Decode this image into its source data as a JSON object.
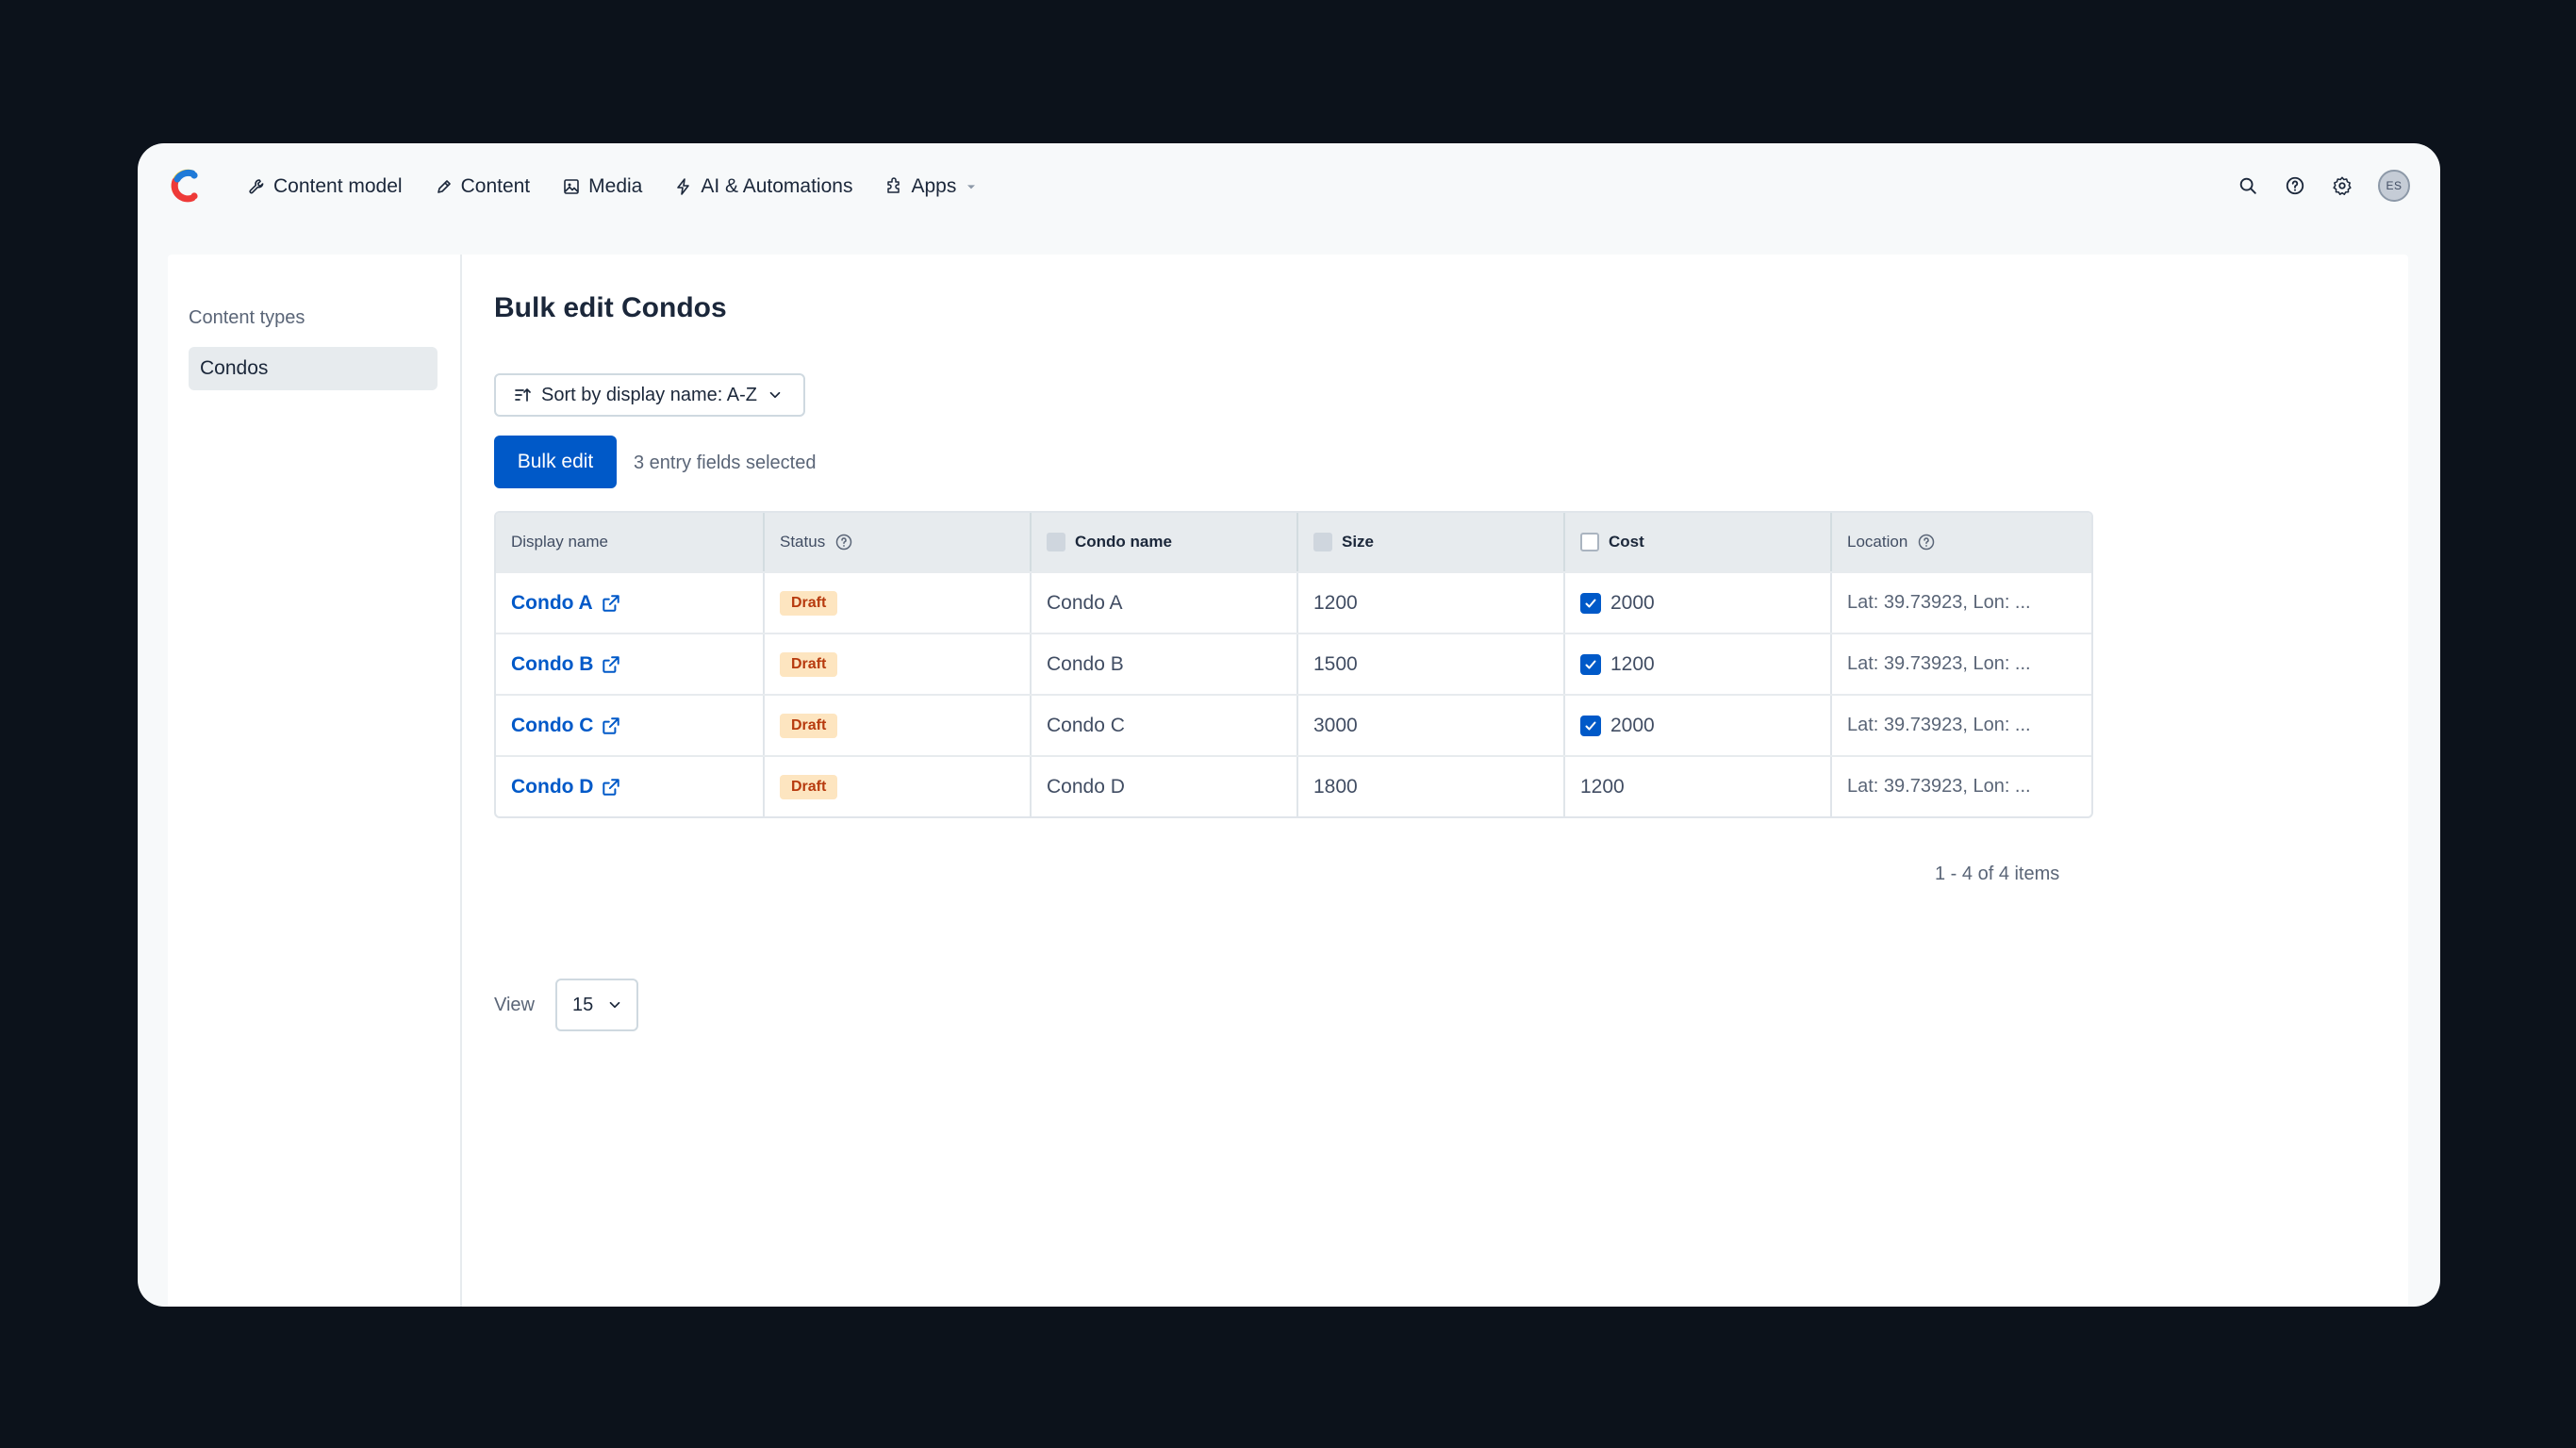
{
  "nav": {
    "items": [
      {
        "label": "Content model",
        "icon": "wrench-icon"
      },
      {
        "label": "Content",
        "icon": "pen-icon"
      },
      {
        "label": "Media",
        "icon": "image-icon"
      },
      {
        "label": "AI & Automations",
        "icon": "lightning-icon"
      },
      {
        "label": "Apps",
        "icon": "puzzle-icon"
      }
    ],
    "avatar_initials": "ES"
  },
  "sidebar": {
    "label": "Content types",
    "items": [
      {
        "label": "Condos"
      }
    ]
  },
  "main": {
    "title": "Bulk edit Condos",
    "sort_label": "Sort by display name: A-Z",
    "bulk_edit_label": "Bulk edit",
    "selected_text": "3 entry fields selected",
    "view_label": "View",
    "page_size": "15",
    "pager_text": "1 - 4 of 4 items"
  },
  "table": {
    "headers": {
      "display_name": "Display name",
      "status": "Status",
      "condo_name": "Condo name",
      "size": "Size",
      "cost": "Cost",
      "location": "Location"
    },
    "rows": [
      {
        "display_name": "Condo A",
        "status": "Draft",
        "condo_name": "Condo A",
        "size": "1200",
        "cost": "2000",
        "cost_checked": true,
        "location": "Lat: 39.73923, Lon: ..."
      },
      {
        "display_name": "Condo B",
        "status": "Draft",
        "condo_name": "Condo B",
        "size": "1500",
        "cost": "1200",
        "cost_checked": true,
        "location": "Lat: 39.73923, Lon: ..."
      },
      {
        "display_name": "Condo C",
        "status": "Draft",
        "condo_name": "Condo C",
        "size": "3000",
        "cost": "2000",
        "cost_checked": true,
        "location": "Lat: 39.73923, Lon: ..."
      },
      {
        "display_name": "Condo D",
        "status": "Draft",
        "condo_name": "Condo D",
        "size": "1800",
        "cost": "1200",
        "cost_checked": false,
        "location": "Lat: 39.73923, Lon: ..."
      }
    ]
  },
  "colors": {
    "accent": "#0059c8",
    "draft_badge_bg": "#fde5c0",
    "draft_badge_text": "#b73a0e",
    "page_bg": "#0c121b"
  }
}
